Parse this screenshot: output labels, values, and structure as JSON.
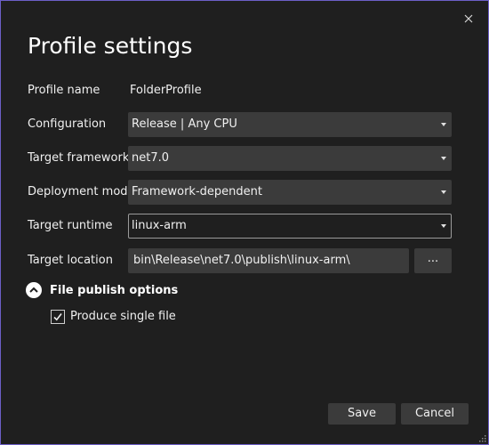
{
  "dialog": {
    "title": "Profile settings",
    "close_icon": "close-icon"
  },
  "fields": {
    "profile_name": {
      "label": "Profile name",
      "value": "FolderProfile"
    },
    "configuration": {
      "label": "Configuration",
      "value": "Release | Any CPU"
    },
    "target_framework": {
      "label": "Target framework",
      "value": "net7.0"
    },
    "deployment_mode": {
      "label": "Deployment mode",
      "value": "Framework-dependent"
    },
    "target_runtime": {
      "label": "Target runtime",
      "value": "linux-arm"
    },
    "target_location": {
      "label": "Target location",
      "value": "bin\\Release\\net7.0\\publish\\linux-arm\\",
      "browse_label": "..."
    }
  },
  "file_publish": {
    "label": "File publish options",
    "expanded": true,
    "produce_single_file": {
      "label": "Produce single file",
      "checked": true
    }
  },
  "footer": {
    "save_label": "Save",
    "cancel_label": "Cancel"
  },
  "colors": {
    "background": "#1f1f1f",
    "border_accent": "#6c5fc7",
    "control_bg": "#3b3b3b"
  }
}
